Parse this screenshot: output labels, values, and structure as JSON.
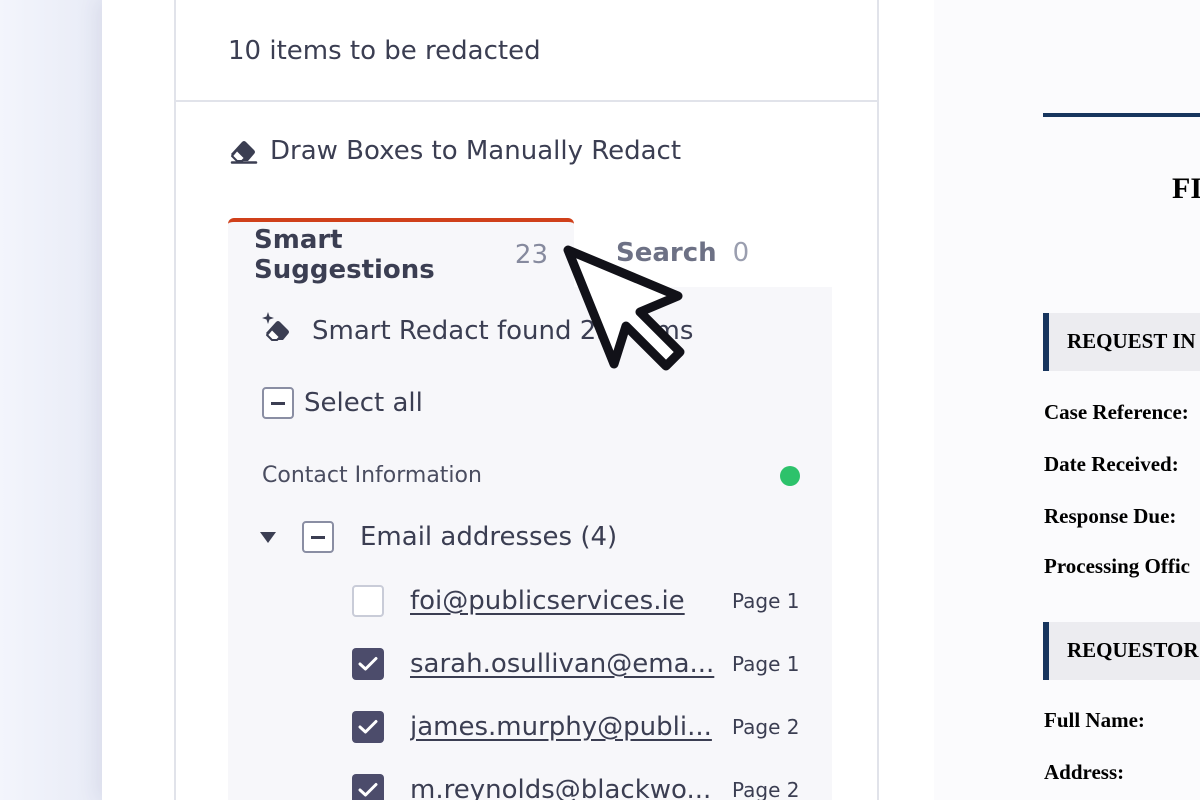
{
  "panel": {
    "header_title": "10 items to be redacted",
    "manual_redact_label": "Draw Boxes to Manually Redact",
    "tabs": [
      {
        "label": "Smart Suggestions",
        "count": "23",
        "active": true
      },
      {
        "label": "Search",
        "count": "0",
        "active": false
      }
    ],
    "found_text": "Smart Redact found 23 items",
    "select_all_label": "Select all",
    "category": {
      "label": "Contact Information",
      "status_color": "#2dc26b"
    },
    "group": {
      "label": "Email addresses (4)"
    },
    "items": [
      {
        "email": "foi@publicservices.ie",
        "page": "Page 1",
        "checked": false
      },
      {
        "email": "sarah.osullivan@ema...",
        "page": "Page 1",
        "checked": true
      },
      {
        "email": "james.murphy@publi...",
        "page": "Page 2",
        "checked": true
      },
      {
        "email": "m.reynolds@blackwo...",
        "page": "Page 2",
        "checked": true
      }
    ]
  },
  "document": {
    "title_fragment": "FI",
    "sections": [
      "REQUEST IN",
      "REQUESTOR"
    ],
    "fields": [
      "Case Reference:",
      "Date Received:",
      "Response Due:",
      "Processing Offic",
      "Full Name:",
      "Address:"
    ]
  },
  "colors": {
    "active_tab_accent": "#d0401a",
    "checkbox_checked": "#4c4c6b",
    "document_accent": "#17355e"
  },
  "icons": [
    "eraser-icon",
    "magic-eraser-icon",
    "mouse-pointer-icon"
  ]
}
